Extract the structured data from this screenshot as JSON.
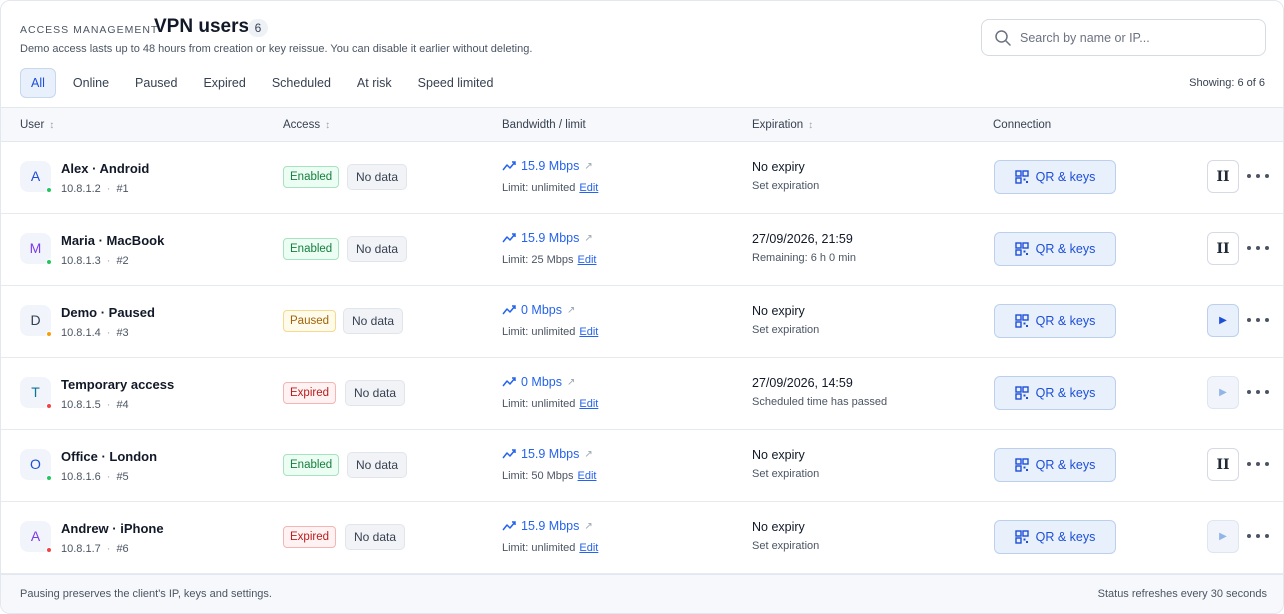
{
  "header": {
    "eyebrow": "ACCESS MANAGEMENT",
    "title": "VPN users",
    "count": "6",
    "subtitle": "Demo access lasts up to 48 hours from creation or key reissue. You can disable it earlier without deleting."
  },
  "search": {
    "placeholder": "Search by name or IP..."
  },
  "tabs": [
    "All",
    "Online",
    "Paused",
    "Expired",
    "Scheduled",
    "At risk",
    "Speed limited"
  ],
  "active_tab": "All",
  "showing": "Showing: 6 of 6",
  "columns": {
    "user": "User",
    "access": "Access",
    "bandwidth": "Bandwidth / limit",
    "expiration": "Expiration",
    "connection": "Connection"
  },
  "users": [
    {
      "initial": "A",
      "avatar_color": "#1d4ed8",
      "online_dot": "#22c55e",
      "name": "Alex · Android",
      "ip": "10.8.1.2",
      "num": "#1",
      "status": "Enabled",
      "status_kind": "enabled",
      "data": "No data",
      "bandwidth": "15.9 Mbps",
      "limit": "Limit: unlimited",
      "edit": "Edit",
      "exp_main": "No expiry",
      "exp_sub": "Set expiration",
      "qr": "QR & keys",
      "action": "pause"
    },
    {
      "initial": "M",
      "avatar_color": "#7c3aed",
      "online_dot": "#22c55e",
      "name": "Maria · MacBook",
      "ip": "10.8.1.3",
      "num": "#2",
      "status": "Enabled",
      "status_kind": "enabled",
      "data": "No data",
      "bandwidth": "15.9 Mbps",
      "limit": "Limit: 25 Mbps",
      "edit": "Edit",
      "exp_main": "27/09/2026, 21:59",
      "exp_sub": "Remaining: 6 h 0 min",
      "qr": "QR & keys",
      "action": "pause"
    },
    {
      "initial": "D",
      "avatar_color": "#374151",
      "online_dot": "#f59e0b",
      "name": "Demo · Paused",
      "ip": "10.8.1.4",
      "num": "#3",
      "status": "Paused",
      "status_kind": "paused",
      "data": "No data",
      "bandwidth": "0 Mbps",
      "limit": "Limit: unlimited",
      "edit": "Edit",
      "exp_main": "No expiry",
      "exp_sub": "Set expiration",
      "qr": "QR & keys",
      "action": "play"
    },
    {
      "initial": "T",
      "avatar_color": "#0e7490",
      "online_dot": "#ef4444",
      "name": "Temporary access",
      "ip": "10.8.1.5",
      "num": "#4",
      "status": "Expired",
      "status_kind": "expired",
      "data": "No data",
      "bandwidth": "0 Mbps",
      "limit": "Limit: unlimited",
      "edit": "Edit",
      "exp_main": "27/09/2026, 14:59",
      "exp_sub": "Scheduled time has passed",
      "qr": "QR & keys",
      "action": "play-disabled"
    },
    {
      "initial": "O",
      "avatar_color": "#1d4ed8",
      "online_dot": "#22c55e",
      "name": "Office · London",
      "ip": "10.8.1.6",
      "num": "#5",
      "status": "Enabled",
      "status_kind": "enabled",
      "data": "No data",
      "bandwidth": "15.9 Mbps",
      "limit": "Limit: 50 Mbps",
      "edit": "Edit",
      "exp_main": "No expiry",
      "exp_sub": "Set expiration",
      "qr": "QR & keys",
      "action": "pause"
    },
    {
      "initial": "A",
      "avatar_color": "#7c3aed",
      "online_dot": "#ef4444",
      "name": "Andrew · iPhone",
      "ip": "10.8.1.7",
      "num": "#6",
      "status": "Expired",
      "status_kind": "expired",
      "data": "No data",
      "bandwidth": "15.9 Mbps",
      "limit": "Limit: unlimited",
      "edit": "Edit",
      "exp_main": "No expiry",
      "exp_sub": "Set expiration",
      "qr": "QR & keys",
      "action": "play-disabled"
    }
  ],
  "footer": {
    "left": "Pausing preserves the client's IP, keys and settings.",
    "right": "Status refreshes every 30 seconds"
  }
}
